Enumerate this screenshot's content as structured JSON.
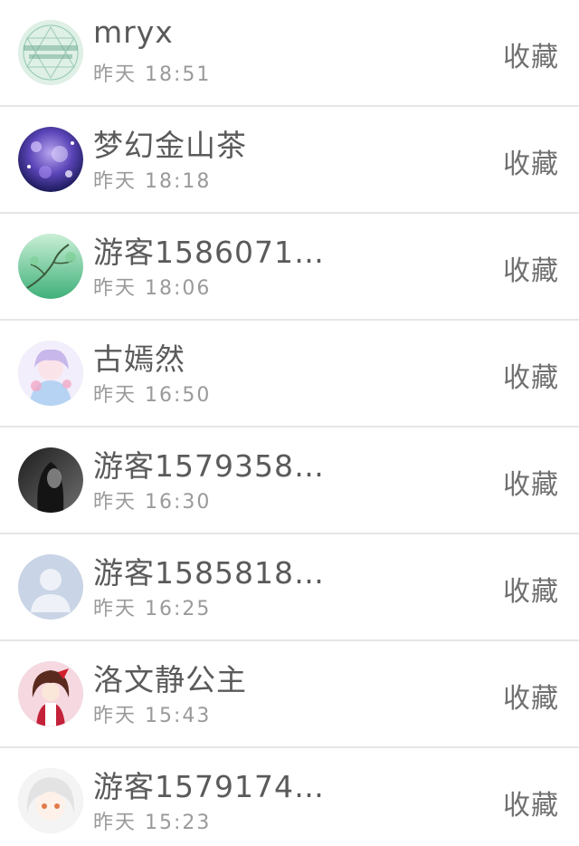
{
  "items": [
    {
      "name": "mryx",
      "time": "昨天 18:51",
      "action": "收藏",
      "avatar": "teal-calligraphy-avatar"
    },
    {
      "name": "梦幻金山茶",
      "time": "昨天 18:18",
      "action": "收藏",
      "avatar": "purple-galaxy-avatar"
    },
    {
      "name": "游客1586071…",
      "time": "昨天 18:06",
      "action": "收藏",
      "avatar": "green-tree-avatar"
    },
    {
      "name": "古嫣然",
      "time": "昨天 16:50",
      "action": "收藏",
      "avatar": "pastel-anime-avatar"
    },
    {
      "name": "游客1579358…",
      "time": "昨天 16:30",
      "action": "收藏",
      "avatar": "dark-portrait-avatar"
    },
    {
      "name": "游客1585818…",
      "time": "昨天 16:25",
      "action": "收藏",
      "avatar": "default-user-avatar"
    },
    {
      "name": "洛文静公主",
      "time": "昨天 15:43",
      "action": "收藏",
      "avatar": "red-anime-avatar"
    },
    {
      "name": "游客1579174…",
      "time": "昨天 15:23",
      "action": "收藏",
      "avatar": "white-anime-avatar"
    }
  ]
}
